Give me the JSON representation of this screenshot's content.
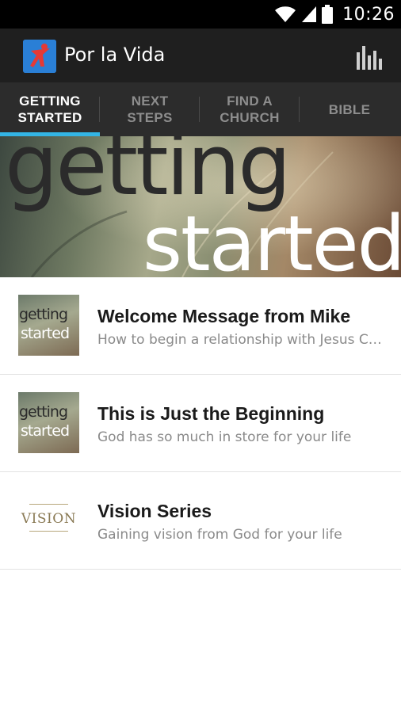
{
  "status_bar": {
    "time": "10:26",
    "icons": [
      "wifi-icon",
      "signal-icon",
      "battery-icon"
    ]
  },
  "action_bar": {
    "app_icon": "app-logo-icon",
    "title": "Por la Vida",
    "stats_icon": "bar-chart-icon"
  },
  "tabs": [
    {
      "label": "GETTING\nSTARTED",
      "active": true
    },
    {
      "label": "NEXT\nSTEPS",
      "active": false
    },
    {
      "label": "FIND A\nCHURCH",
      "active": false
    },
    {
      "label": "BIBLE",
      "active": false
    }
  ],
  "banner": {
    "word1": "getting",
    "word2": "started"
  },
  "items": [
    {
      "thumb_line1": "getting",
      "thumb_line2": "started",
      "title": "Welcome Message from Mike",
      "subtitle": "How to begin a relationship with Jesus Christ"
    },
    {
      "thumb_line1": "getting",
      "thumb_line2": "started",
      "title": "This is Just the Beginning",
      "subtitle": "God has so much in store for your life"
    },
    {
      "thumb_text": "VISION",
      "title": "Vision Series",
      "subtitle": "Gaining vision from God for your life"
    }
  ],
  "colors": {
    "status_bar": "#000000",
    "action_bar": "#1f1f1f",
    "tab_bar": "#2c2c2c",
    "tab_indicator": "#33b5e5",
    "app_icon_bg": "#2a7fd6",
    "app_icon_figure": "#e53935"
  }
}
